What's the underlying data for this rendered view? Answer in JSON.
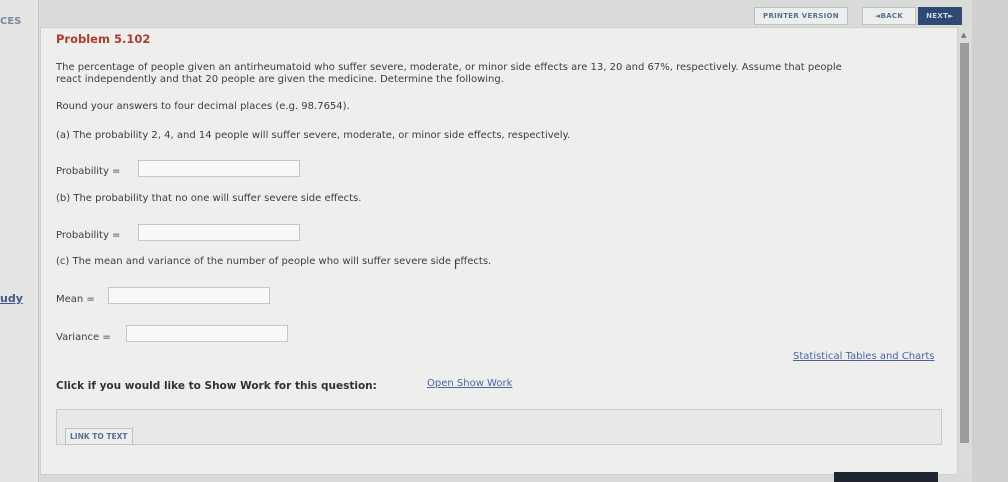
{
  "nav": {
    "top_label": "CES",
    "study_label": "udy"
  },
  "toolbar": {
    "printer_version": "PRINTER VERSION",
    "back": "◄BACK",
    "next": "NEXT►"
  },
  "problem": {
    "title": "Problem 5.102",
    "statement_line1": "The percentage of people given an antirheumatoid who suffer severe, moderate, or minor side effects are 13, 20 and 67%, respectively. Assume that people",
    "statement_line2": "react independently and that 20 people are given the medicine. Determine the following.",
    "rounding": "Round your answers to four decimal places (e.g. 98.7654).",
    "part_a": "(a) The probability 2, 4, and 14 people will suffer severe, moderate, or minor side effects, respectively.",
    "part_b": "(b) The probability that no one will suffer severe side effects.",
    "part_c": "(c) The mean and variance of the number of people who will suffer severe side effects."
  },
  "fields": {
    "prob_a": {
      "label": "Probability =",
      "value": ""
    },
    "prob_b": {
      "label": "Probability =",
      "value": ""
    },
    "mean": {
      "label": "Mean =",
      "value": ""
    },
    "variance": {
      "label": "Variance =",
      "value": ""
    }
  },
  "links": {
    "stat_tables": "Statistical Tables and Charts",
    "show_work_prompt": "Click if you would like to Show Work for this question:",
    "open_show_work": "Open Show Work",
    "link_to_text": "LINK TO TEXT"
  }
}
